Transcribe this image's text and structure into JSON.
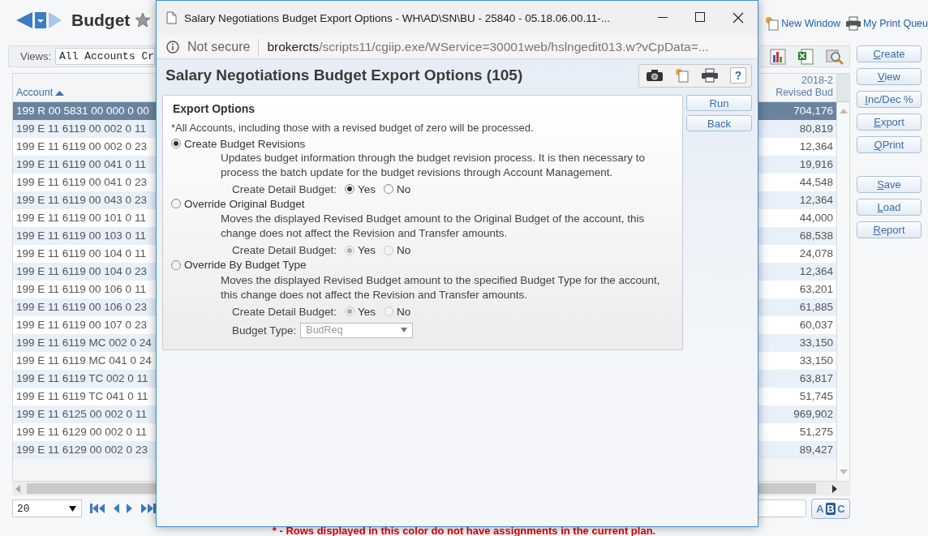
{
  "app": {
    "title": "Budget",
    "header_links": [
      {
        "label": "New Window",
        "kind": "window"
      },
      {
        "label": "My Print Queu",
        "kind": "print"
      }
    ],
    "views": {
      "label": "Views:",
      "value": "All Accounts Cr"
    },
    "grid": {
      "columns": [
        {
          "label_lines": [
            "Account"
          ],
          "sorted": true
        },
        {
          "label_lines": [
            "2018-2",
            "Revised Bud"
          ],
          "sorted": false
        }
      ],
      "rows": [
        {
          "account": "199 R 00 5831 00 000 0 00",
          "value": "704,176",
          "selected": true
        },
        {
          "account": "199 E 11 6119 00 002 0 11",
          "value": "80,819",
          "selected": false
        },
        {
          "account": "199 E 11 6119 00 002 0 23",
          "value": "12,364",
          "selected": false
        },
        {
          "account": "199 E 11 6119 00 041 0 11",
          "value": "19,916",
          "selected": false
        },
        {
          "account": "199 E 11 6119 00 041 0 23",
          "value": "44,548",
          "selected": false
        },
        {
          "account": "199 E 11 6119 00 043 0 23",
          "value": "12,364",
          "selected": false
        },
        {
          "account": "199 E 11 6119 00 101 0 11",
          "value": "44,000",
          "selected": false
        },
        {
          "account": "199 E 11 6119 00 103 0 11",
          "value": "68,538",
          "selected": false
        },
        {
          "account": "199 E 11 6119 00 104 0 11",
          "value": "24,078",
          "selected": false
        },
        {
          "account": "199 E 11 6119 00 104 0 23",
          "value": "12,364",
          "selected": false
        },
        {
          "account": "199 E 11 6119 00 106 0 11",
          "value": "63,201",
          "selected": false
        },
        {
          "account": "199 E 11 6119 00 106 0 23",
          "value": "61,885",
          "selected": false
        },
        {
          "account": "199 E 11 6119 00 107 0 23",
          "value": "60,037",
          "selected": false
        },
        {
          "account": "199 E 11 6119 MC 002 0 24",
          "value": "33,150",
          "selected": false
        },
        {
          "account": "199 E 11 6119 MC 041 0 24",
          "value": "33,150",
          "selected": false
        },
        {
          "account": "199 E 11 6119 TC 002 0 11",
          "value": "63,817",
          "selected": false
        },
        {
          "account": "199 E 11 6119 TC 041 0 11",
          "value": "51,745",
          "selected": false
        },
        {
          "account": "199 E 11 6125 00 002 0 11",
          "value": "969,902",
          "selected": false
        },
        {
          "account": "199 E 11 6129 00 002 0 11",
          "value": "51,275",
          "selected": false
        },
        {
          "account": "199 E 11 6129 00 002 0 23",
          "value": "89,427",
          "selected": false
        }
      ]
    },
    "pager": {
      "page_size": "20"
    },
    "side_buttons": [
      [
        "Create",
        "View",
        "Inc/Dec %",
        "Export",
        "QPrint"
      ],
      [
        "Save",
        "Load",
        "Report"
      ]
    ],
    "abc_button": {
      "letters": [
        {
          "label": "A",
          "selected": false
        },
        {
          "label": "B",
          "selected": true
        },
        {
          "label": "C",
          "selected": false
        }
      ]
    },
    "footer_note": "* - Rows displayed in this color do not have assignments in the current plan."
  },
  "dialog": {
    "window_title": "Salary Negotiations Budget Export Options - WH\\AD\\SN\\BU - 25840 - 05.18.06.00.11-...",
    "security": "Not secure",
    "url_host": "brokercts",
    "url_path": "/scripts11/cgiip.exe/WService=30001web/hslngedit013.w?vCpData=...",
    "heading": "Salary Negotiations Budget Export Options (105)",
    "help": "?",
    "section_title": "Export Options",
    "note": "*All Accounts, including those with a revised budget of zero will be processed.",
    "options": [
      {
        "label": "Create Budget Revisions",
        "selected": true,
        "description": "Updates budget information through the budget revision process. It is then necessary to process the batch update for the budget revisions through Account Management.",
        "detail_label": "Create Detail Budget:",
        "detail_disabled": false,
        "detail_choices": [
          {
            "label": "Yes",
            "selected": true
          },
          {
            "label": "No",
            "selected": false
          }
        ]
      },
      {
        "label": "Override Original Budget",
        "selected": false,
        "description": "Moves the displayed Revised Budget amount to the Original Budget of the account, this change does not affect the Revision and Transfer amounts.",
        "detail_label": "Create Detail Budget:",
        "detail_disabled": true,
        "detail_choices": [
          {
            "label": "Yes",
            "selected": true
          },
          {
            "label": "No",
            "selected": false
          }
        ]
      },
      {
        "label": "Override By Budget Type",
        "selected": false,
        "description": "Moves the displayed Revised Budget amount to the specified Budget Type for the account, this change does not affect the Revision and Transfer amounts.",
        "detail_label": "Create Detail Budget:",
        "detail_disabled": true,
        "detail_choices": [
          {
            "label": "Yes",
            "selected": true
          },
          {
            "label": "No",
            "selected": false
          }
        ],
        "budget_type": {
          "label": "Budget Type:",
          "value": "BudReq",
          "disabled": true
        }
      }
    ],
    "buttons": [
      "Run",
      "Back"
    ]
  }
}
